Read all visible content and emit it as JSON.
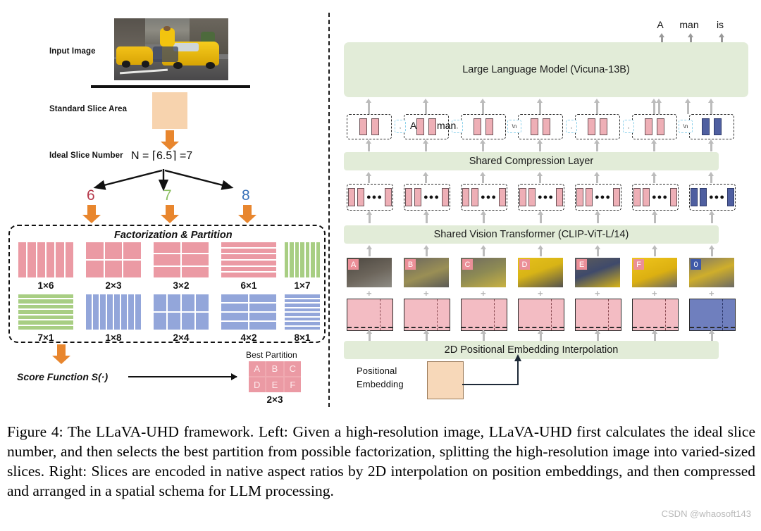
{
  "figure": {
    "caption": "Figure 4: The LLaVA-UHD framework. Left: Given a high-resolution image, LLaVA-UHD first calculates the ideal slice number, and then selects the best partition from possible factorization, splitting the high-resolution image into varied-sized slices. Right: Slices are encoded in native aspect ratios by 2D interpolation on position embeddings, and then compressed and arranged in a spatial schema for LLM processing.",
    "watermark": "CSDN @whaosoft143"
  },
  "left": {
    "input_image_label": "Input Image",
    "standard_slice_area_label": "Standard Slice Area",
    "ideal_slice_number_label": "Ideal Slice Number",
    "formula": "N = ⌈6.5⌉ =7",
    "branches": [
      {
        "value": "6",
        "color": "#b5384a"
      },
      {
        "value": "7",
        "color": "#8cc063"
      },
      {
        "value": "8",
        "color": "#3b73b9"
      }
    ],
    "factorization_title": "Factorization & Partition",
    "factorizations": [
      {
        "label": "1×6",
        "rows": 1,
        "cols": 6,
        "color": "#eb9aa4"
      },
      {
        "label": "2×3",
        "rows": 2,
        "cols": 3,
        "color": "#eb9aa4"
      },
      {
        "label": "3×2",
        "rows": 3,
        "cols": 2,
        "color": "#eb9aa4"
      },
      {
        "label": "6×1",
        "rows": 6,
        "cols": 1,
        "color": "#eb9aa4"
      },
      {
        "label": "1×7",
        "rows": 1,
        "cols": 7,
        "color": "#a8ce83"
      },
      {
        "label": "7×1",
        "rows": 7,
        "cols": 1,
        "color": "#a8ce83"
      },
      {
        "label": "1×8",
        "rows": 1,
        "cols": 8,
        "color": "#93a6da"
      },
      {
        "label": "2×4",
        "rows": 2,
        "cols": 4,
        "color": "#93a6da"
      },
      {
        "label": "4×2",
        "rows": 4,
        "cols": 2,
        "color": "#93a6da"
      },
      {
        "label": "8×1",
        "rows": 8,
        "cols": 1,
        "color": "#93a6da"
      }
    ],
    "score_function": "Score Function S(·)",
    "best_partition_label": "Best Partition",
    "best_partition_cells": [
      "A",
      "B",
      "C",
      "D",
      "E",
      "F"
    ],
    "best_partition_label_bottom": "2×3"
  },
  "right": {
    "llm_label": "Large Language Model (Vicuna-13B)",
    "compression_label": "Shared Compression Layer",
    "vision_label": "Shared Vision Transformer (CLIP-ViT-L/14)",
    "pos_embed_layer_label": "2D Positional Embedding Interpolation",
    "positional_embedding_label": "Positional\nEmbedding",
    "positional_embedding_line1": "Positional",
    "positional_embedding_line2": "Embedding",
    "output_tokens": [
      "A",
      "man",
      "is"
    ],
    "input_text_tokens": [
      "A",
      "man"
    ],
    "separators": [
      ",",
      ",",
      "\\n",
      ",",
      ",",
      "\\n"
    ],
    "slice_tags": [
      "A",
      "B",
      "C",
      "D",
      "E",
      "F",
      "0"
    ],
    "token_group_count": 7,
    "vision_group_dots": "●●●"
  },
  "colors": {
    "pink": "#eb9aa4",
    "green_tile": "#a8ce83",
    "blue_tile": "#93a6da",
    "orange_arrow": "#e8862e",
    "peach": "#f7d3ae",
    "green_bar": "#e2ecd8",
    "overview_blue": "#4f5fa0"
  }
}
